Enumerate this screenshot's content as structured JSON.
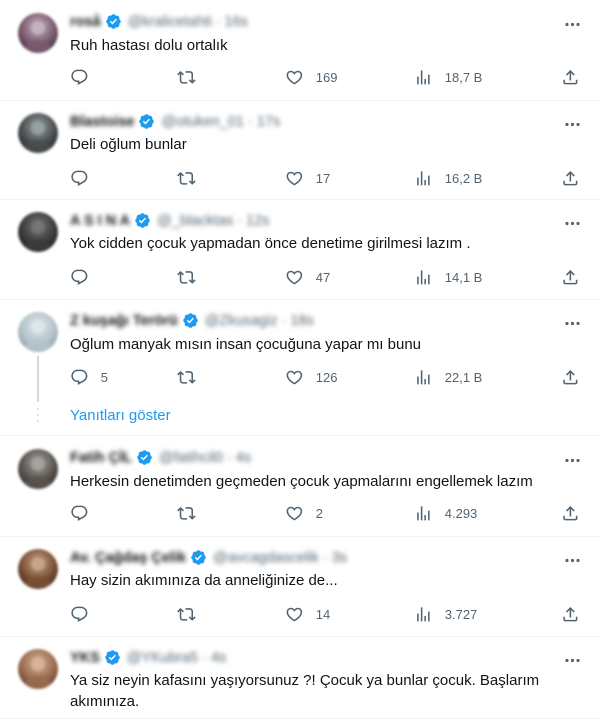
{
  "colors": {
    "verified": "#1d9bf0",
    "icon": "#536471",
    "link": "#1d9bf0",
    "divider": "#eff3f4"
  },
  "icons": {
    "reply": "reply-icon",
    "retweet": "retweet-icon",
    "like": "heart-icon",
    "views": "views-icon",
    "share": "share-icon",
    "more": "more-icon",
    "verified": "verified-badge-icon"
  },
  "tweets": [
    {
      "name": "roså",
      "handle": "@kralicetahti · 16s",
      "text": "Ruh hastası dolu ortalık",
      "replies": "",
      "retweets": "",
      "likes": "169",
      "views": "18,7 B"
    },
    {
      "name": "Blastoise",
      "handle": "@otuken_01 · 17s",
      "text": "Deli oğlum bunlar",
      "replies": "",
      "retweets": "",
      "likes": "17",
      "views": "16,2 B"
    },
    {
      "name": "A S I N A",
      "handle": "@_blacktas · 12s",
      "text": "Yok cidden çocuk yapmadan önce denetime girilmesi lazım .",
      "replies": "",
      "retweets": "",
      "likes": "47",
      "views": "14,1 B"
    },
    {
      "name": "Z kuşağı Terörü",
      "handle": "@Zkusagiz · 18s",
      "text": "Oğlum manyak mısın insan çocuğuna yapar mı bunu",
      "replies": "5",
      "retweets": "",
      "likes": "126",
      "views": "22,1 B"
    },
    {
      "name": "Fatih ÇİL",
      "handle": "@fatihcil0 · 4s",
      "text": "Herkesin denetimden geçmeden çocuk yapmalarını engellemek lazım",
      "replies": "",
      "retweets": "",
      "likes": "2",
      "views": "4.293"
    },
    {
      "name": "Av. Çağdaş Çelik",
      "handle": "@avcagdascelik · 3s",
      "text": "Hay sizin akımınıza da anneliğinize de...",
      "replies": "",
      "retweets": "",
      "likes": "14",
      "views": "3.727"
    },
    {
      "name": "YKS",
      "handle": "@YKubra5 · 4s",
      "text": "Ya siz neyin kafasını yaşıyorsunuz ?! Çocuk ya bunlar çocuk. Başlarım akımınıza.",
      "replies": "",
      "retweets": "",
      "likes": "",
      "views": ""
    }
  ],
  "show_replies": "Yanıtları göster"
}
